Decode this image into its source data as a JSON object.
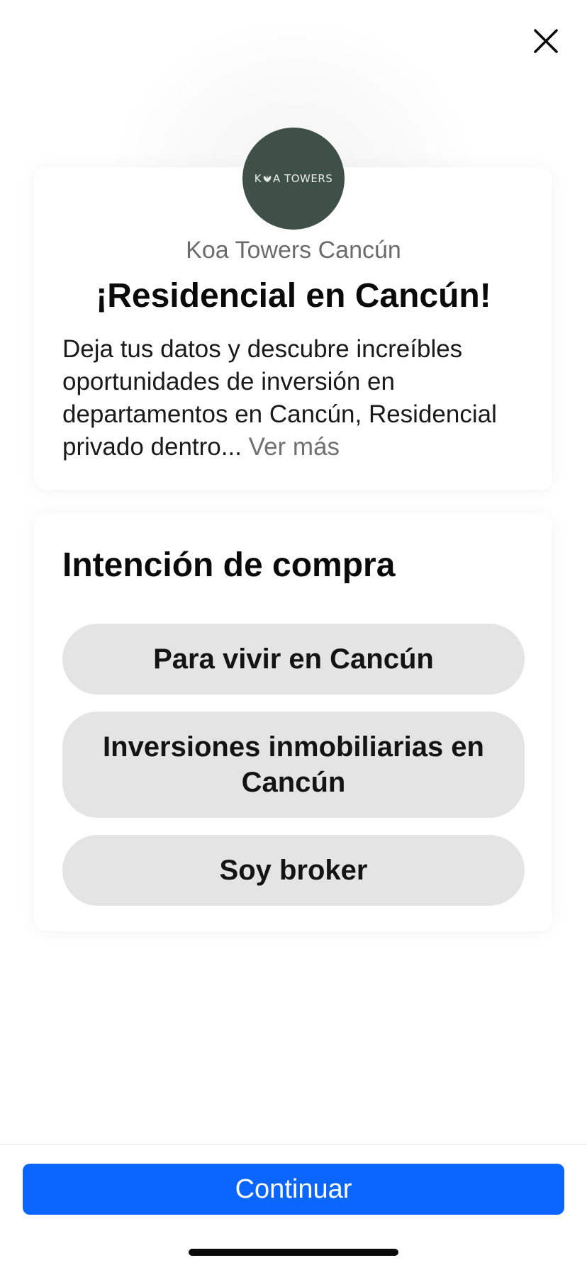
{
  "header": {
    "close_icon": "close-icon"
  },
  "advertiser": {
    "logo_text": "K A TOWERS",
    "logo_part1": "K",
    "logo_part2": "A TOWERS",
    "name": "Koa Towers Cancún"
  },
  "intro": {
    "headline": "¡Residencial en Cancún!",
    "description": "Deja tus datos y descubre increíbles oportunidades de inversión en departamentos en Cancún, Residencial privado dentro...",
    "see_more": "Ver más"
  },
  "question": {
    "title": "Intención de compra",
    "options": [
      {
        "label": "Para vivir en Cancún"
      },
      {
        "label": "Inversiones inmobiliarias en Cancún"
      },
      {
        "label": "Soy broker"
      }
    ]
  },
  "footer": {
    "continue_label": "Continuar"
  },
  "colors": {
    "primary": "#0a66ff",
    "logo_bg": "#3e5048",
    "option_bg": "#e4e4e4"
  }
}
